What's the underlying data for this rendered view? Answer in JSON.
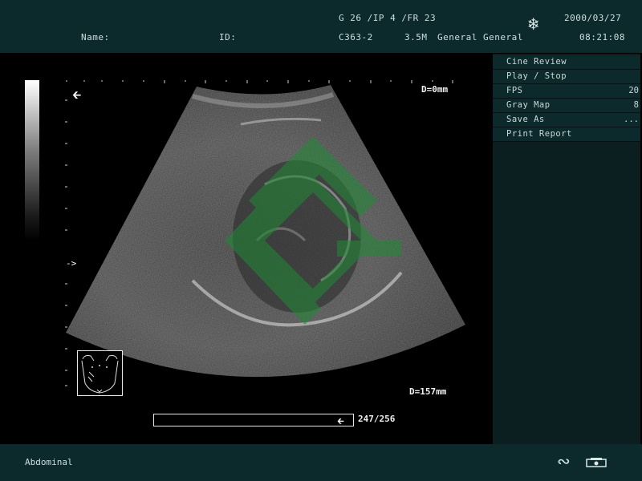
{
  "header": {
    "name_label": "Name:",
    "id_label": "ID:",
    "params": "G 26 /IP 4 /FR 23",
    "probe": "C363-2",
    "frequency": "3.5M",
    "exam": "General General",
    "date": "2000/03/27",
    "time": "08:21:08",
    "freeze_icon": "snowflake-icon"
  },
  "menu": {
    "items": [
      {
        "label": "Cine Review",
        "value": ""
      },
      {
        "label": "Play / Stop",
        "value": ""
      },
      {
        "label": "FPS",
        "value": "20"
      },
      {
        "label": "Gray Map",
        "value": "8"
      },
      {
        "label": "Save As",
        "value": "..."
      },
      {
        "label": "Print Report",
        "value": ""
      }
    ]
  },
  "image": {
    "depth_top": "D=0mm",
    "depth_bottom": "D=157mm"
  },
  "cine": {
    "frame_count": "247/256",
    "progress": 0.965
  },
  "footer": {
    "preset": "Abdominal",
    "wave_icon": "wave-icon",
    "printer_icon": "printer-icon"
  }
}
